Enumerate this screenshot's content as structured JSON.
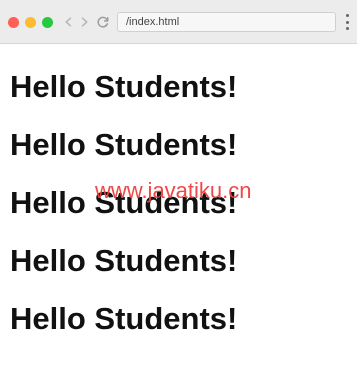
{
  "browser": {
    "address": "/index.html"
  },
  "page": {
    "headings": [
      "Hello Students!",
      "Hello Students!",
      "Hello Students!",
      "Hello Students!",
      "Hello Students!"
    ],
    "watermark": "www.javatiku.cn"
  },
  "colors": {
    "close": "#ff5f57",
    "minimize": "#febc2e",
    "zoom": "#28c840",
    "watermark": "#ef3f3f"
  },
  "icons": {
    "back": "arrow-left-icon",
    "forward": "arrow-right-icon",
    "reload": "reload-icon",
    "menu": "kebab-menu-icon"
  }
}
